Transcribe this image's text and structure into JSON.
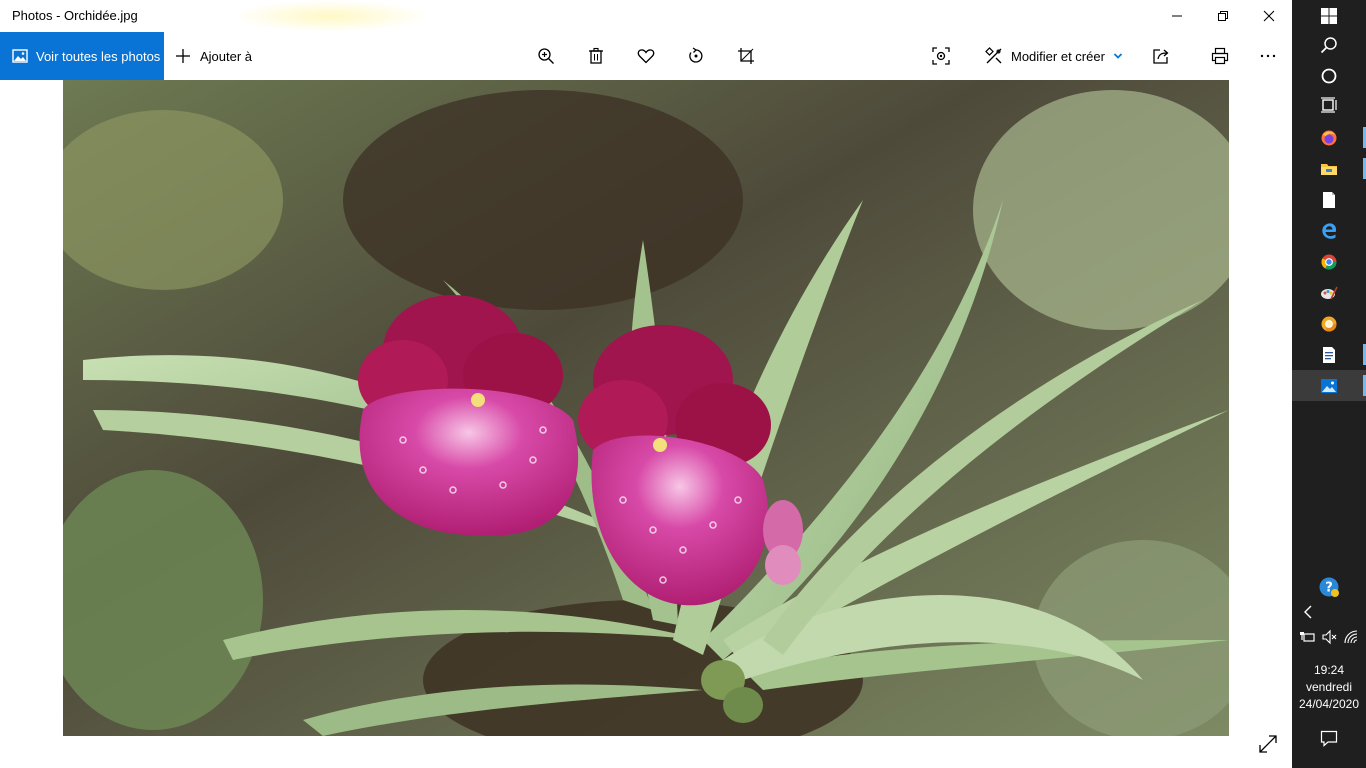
{
  "window": {
    "title": "Photos - Orchidée.jpg"
  },
  "toolbar": {
    "all_photos_label": "Voir toutes les photos",
    "add_to_label": "Ajouter à",
    "edit_create_label": "Modifier et créer",
    "icons": [
      "zoom-icon",
      "delete-icon",
      "favorite-icon",
      "rotate-icon",
      "crop-icon",
      "enhance-icon",
      "edit-icon",
      "share-icon",
      "print-icon",
      "more-icon"
    ]
  },
  "photo": {
    "description_icon": "photo-image"
  },
  "taskbar": {
    "apps": [
      "start",
      "search",
      "cortana",
      "task-view",
      "firefox",
      "file-explorer",
      "notepad",
      "edge",
      "chrome",
      "paint",
      "chrome-alt",
      "word-doc",
      "photos"
    ],
    "time": "19:24",
    "day": "vendredi",
    "date": "24/04/2020"
  },
  "colors": {
    "accent": "#0a74d6",
    "taskbar": "#1f1f1f",
    "pin": "#76b9ed"
  }
}
